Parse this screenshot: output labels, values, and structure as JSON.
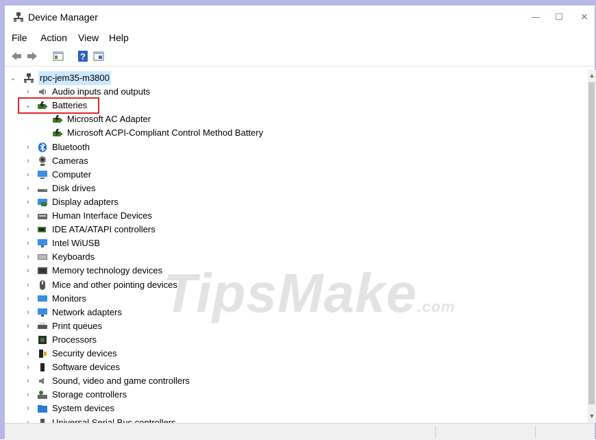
{
  "window": {
    "title": "Device Manager",
    "minimize": "—",
    "maximize": "☐",
    "close": "✕"
  },
  "menu": [
    "File",
    "Action",
    "View",
    "Help"
  ],
  "toolbar": [
    "back-icon",
    "forward-icon",
    "properties-icon",
    "help-icon",
    "scan-hardware-icon"
  ],
  "watermark": {
    "main": "TipsMake",
    "suffix": ".com"
  },
  "tree": {
    "root": "rpc-jem35-m3800",
    "categories": [
      {
        "label": "Audio inputs and outputs",
        "icon": "speaker-icon",
        "expanded": false
      },
      {
        "label": "Batteries",
        "icon": "battery-icon",
        "expanded": true,
        "children": [
          "Microsoft AC Adapter",
          "Microsoft ACPI-Compliant Control Method Battery"
        ]
      },
      {
        "label": "Bluetooth",
        "icon": "bluetooth-icon",
        "expanded": false
      },
      {
        "label": "Cameras",
        "icon": "camera-icon",
        "expanded": false
      },
      {
        "label": "Computer",
        "icon": "computer-icon",
        "expanded": false
      },
      {
        "label": "Disk drives",
        "icon": "disk-drive-icon",
        "expanded": false
      },
      {
        "label": "Display adapters",
        "icon": "display-adapter-icon",
        "expanded": false
      },
      {
        "label": "Human Interface Devices",
        "icon": "hid-icon",
        "expanded": false
      },
      {
        "label": "IDE ATA/ATAPI controllers",
        "icon": "ide-controller-icon",
        "expanded": false
      },
      {
        "label": "Intel WiUSB",
        "icon": "network-icon",
        "expanded": false
      },
      {
        "label": "Keyboards",
        "icon": "keyboard-icon",
        "expanded": false
      },
      {
        "label": "Memory technology devices",
        "icon": "memory-icon",
        "expanded": false
      },
      {
        "label": "Mice and other pointing devices",
        "icon": "mouse-icon",
        "expanded": false
      },
      {
        "label": "Monitors",
        "icon": "monitor-icon",
        "expanded": false
      },
      {
        "label": "Network adapters",
        "icon": "network-adapter-icon",
        "expanded": false
      },
      {
        "label": "Print queues",
        "icon": "printer-icon",
        "expanded": false
      },
      {
        "label": "Processors",
        "icon": "processor-icon",
        "expanded": false
      },
      {
        "label": "Security devices",
        "icon": "security-icon",
        "expanded": false
      },
      {
        "label": "Software devices",
        "icon": "software-device-icon",
        "expanded": false
      },
      {
        "label": "Sound, video and game controllers",
        "icon": "sound-icon",
        "expanded": false
      },
      {
        "label": "Storage controllers",
        "icon": "storage-icon",
        "expanded": false
      },
      {
        "label": "System devices",
        "icon": "system-folder-icon",
        "expanded": false
      },
      {
        "label": "Universal Serial Bus controllers",
        "icon": "usb-icon",
        "expanded": false
      }
    ]
  },
  "colors": {
    "frame": "#b9b6e8",
    "highlight": "#e0262a",
    "selection": "#cce8ff"
  }
}
